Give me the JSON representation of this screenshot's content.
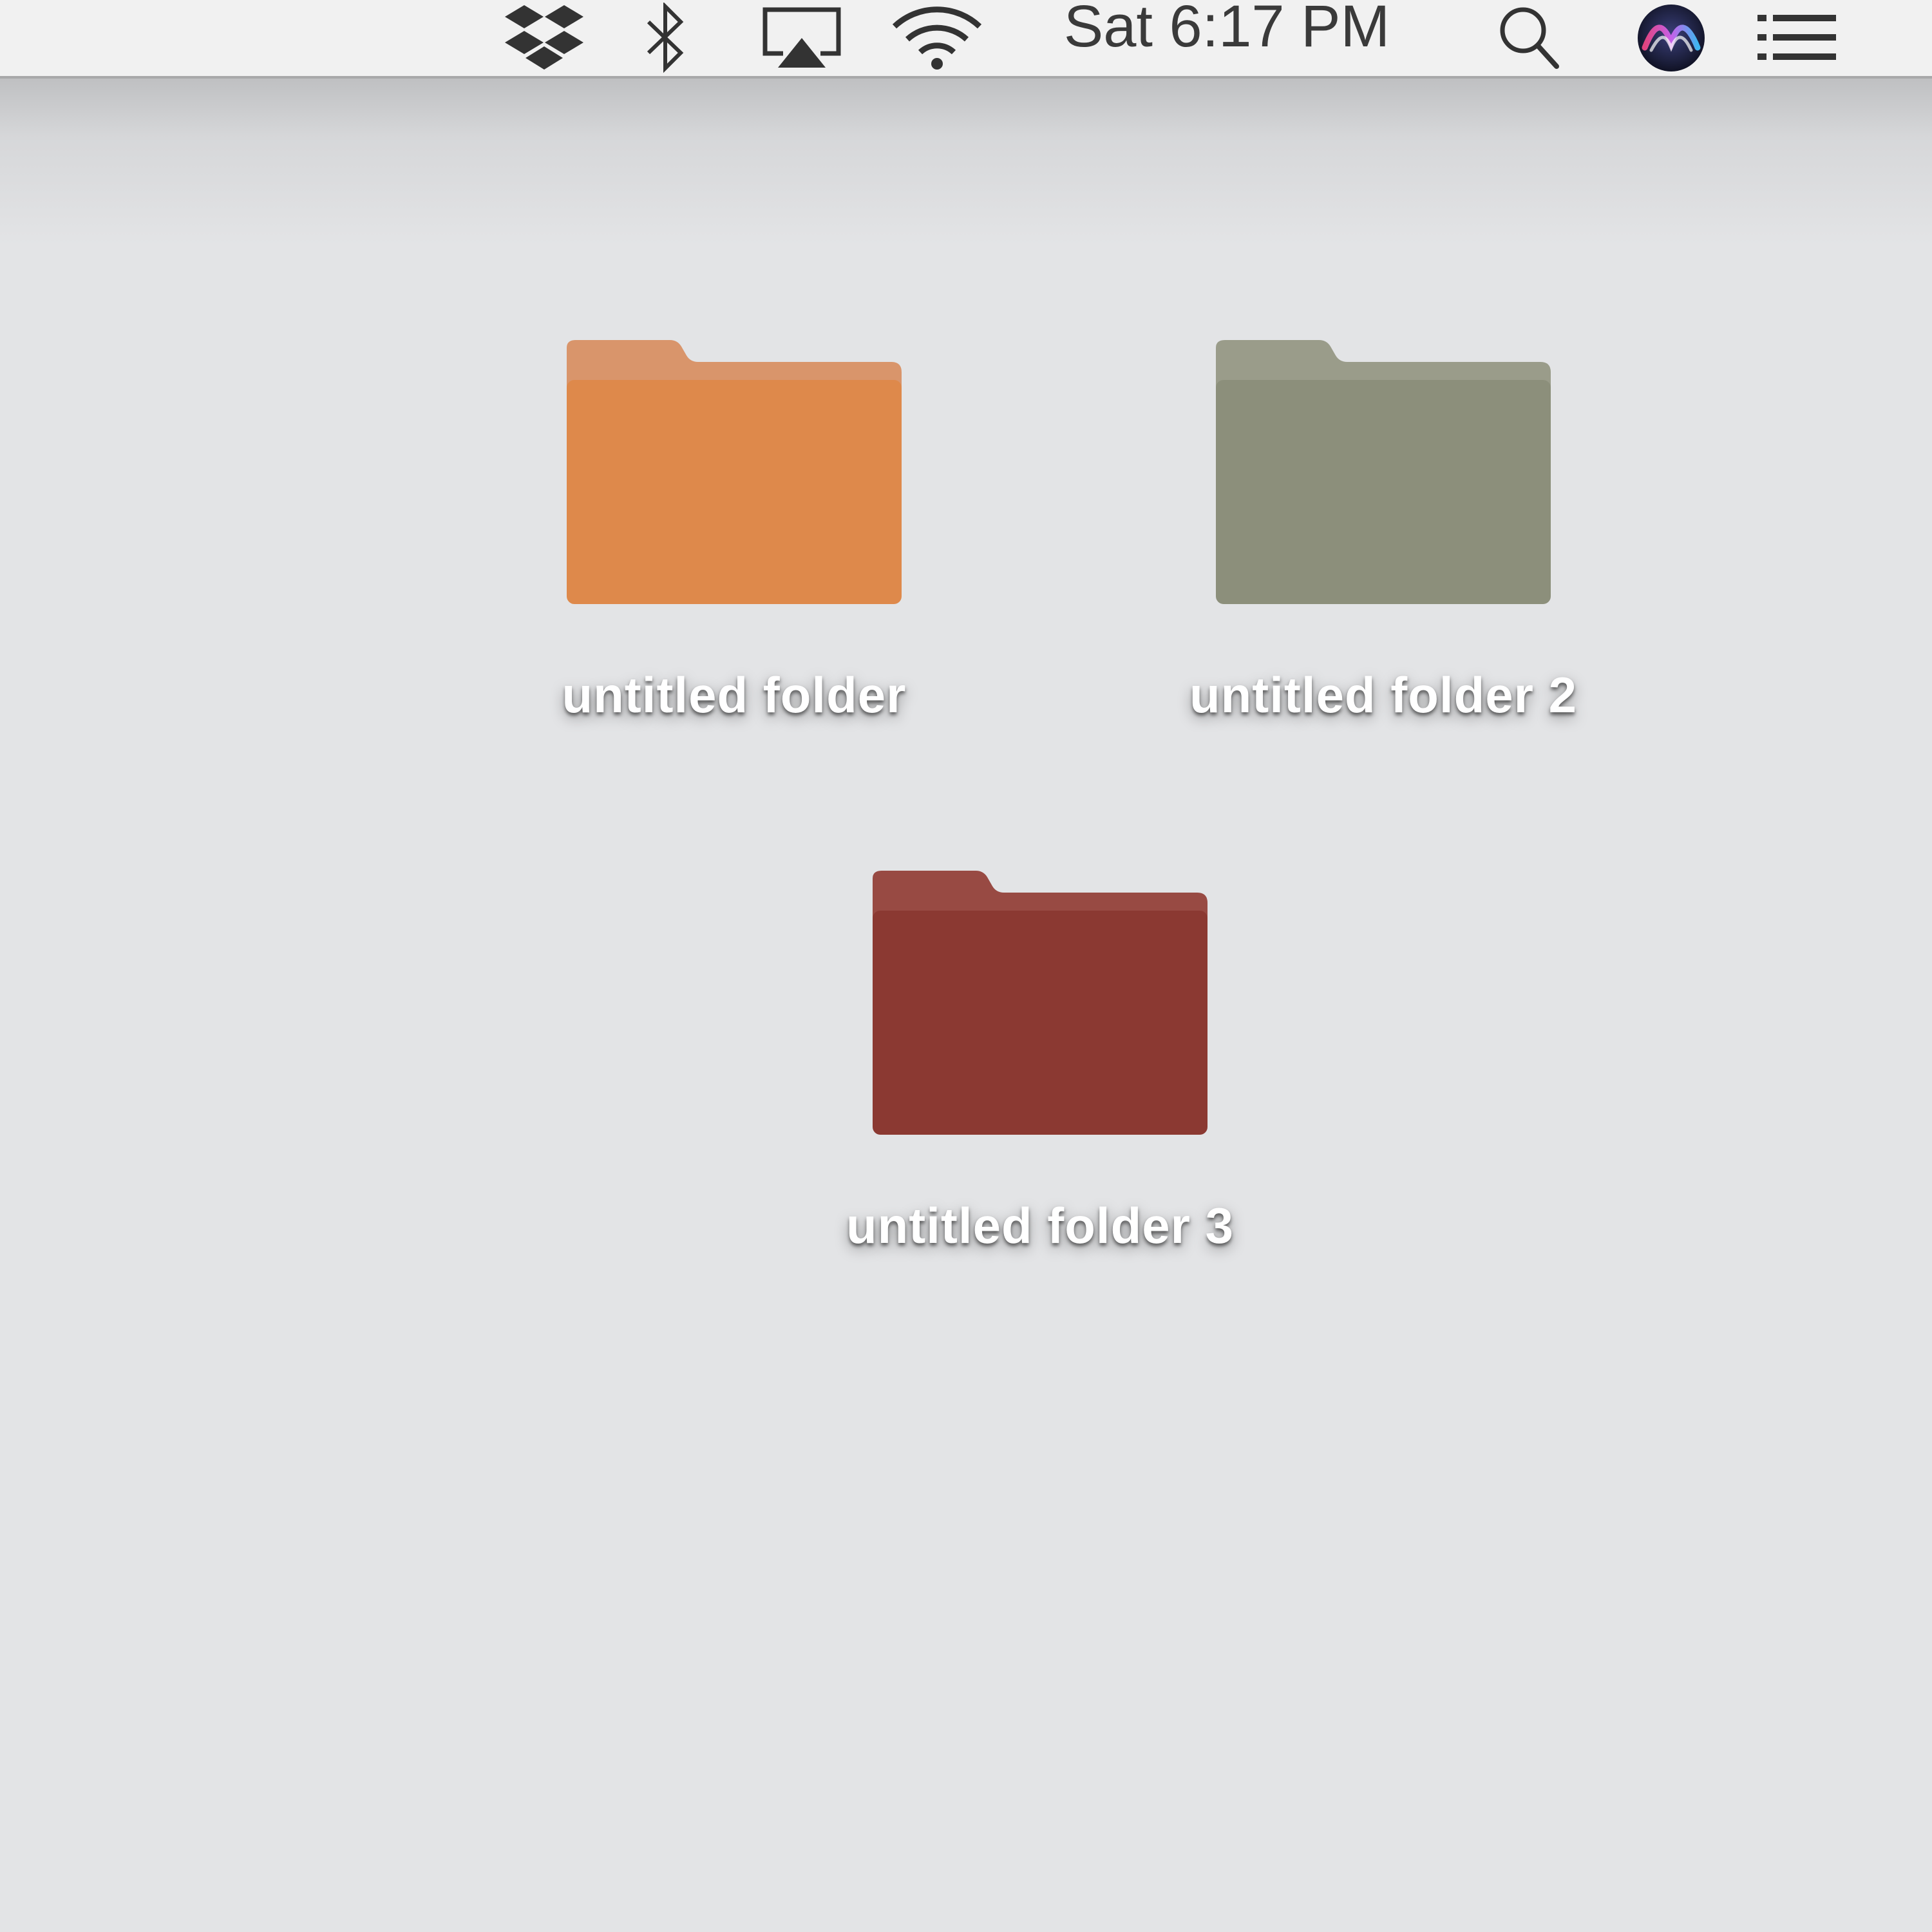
{
  "menubar": {
    "clock": "Sat 6:17 PM",
    "icons": [
      "dropbox-icon",
      "bluetooth-icon",
      "airplay-icon",
      "wifi-icon",
      "spotlight-search-icon",
      "siri-icon",
      "notification-center-icon"
    ]
  },
  "desktop": {
    "folders": [
      {
        "label": "untitled folder",
        "color": "#de894b",
        "tab_color": "#d9956b"
      },
      {
        "label": "untitled folder 2",
        "color": "#8c8f7b",
        "tab_color": "#9a9c8a"
      },
      {
        "label": "untitled folder 3",
        "color": "#8b3932",
        "tab_color": "#984a43"
      }
    ]
  }
}
